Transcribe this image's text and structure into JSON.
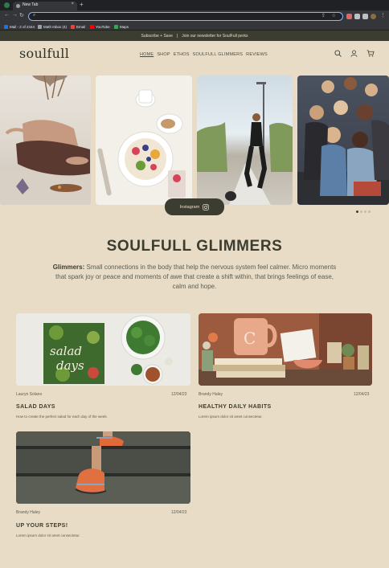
{
  "browser": {
    "tab_title": "New Tab",
    "tab_close": "×",
    "new_tab": "+",
    "back": "←",
    "forward": "→",
    "reload": "↻",
    "url": "",
    "omni_right": "⇪ ☆",
    "menu_glyph": "⋮",
    "bookmarks": [
      {
        "label": "Mail - 2 of 2444",
        "color": "#1a73e8"
      },
      {
        "label": "Math Inbox (4)",
        "color": "#9aa0a6"
      },
      {
        "label": "Email",
        "color": "#ea4335"
      },
      {
        "label": "YouTube",
        "color": "#ff0000"
      },
      {
        "label": "Maps",
        "color": "#34a853"
      }
    ]
  },
  "announcement": {
    "left": "Subscribe + Save",
    "sep": "|",
    "right": "Join our newsletter for SoulFull perks"
  },
  "header": {
    "logo": "soulfull",
    "nav": [
      "HOME",
      "SHOP",
      "ETHOS",
      "SOULFULL GLIMMERS",
      "REVIEWS"
    ]
  },
  "instagram": {
    "label": "Instagram"
  },
  "carousel": {
    "dots": 4,
    "active": 0
  },
  "section": {
    "title": "SOULFULL GLIMMERS",
    "intro_bold": "Glimmers:",
    "intro_text": " Small connections in the body that help the nervous system feel calmer. Micro moments that spark joy or peace and moments of awe that create a shift within, that brings feelings of ease, calm and hope."
  },
  "posts": [
    {
      "author": "Lauryn Solano",
      "date": "12/04/23",
      "title": "SALAD DAYS",
      "desc": "How to create the perfect salad for each day of the week.",
      "book_text_1": "salad",
      "book_text_2": "days"
    },
    {
      "author": "Brandy Haley",
      "date": "12/04/23",
      "title": "HEALTHY DAILY HABITS",
      "desc": "Lorem ipsum dolor sit amet consectetur.",
      "mug_letter": "C"
    },
    {
      "author": "Brandy Haley",
      "date": "12/04/23",
      "title": "UP YOUR STEPS!",
      "desc": "Lorem ipsum dolor sit amet consectetur."
    }
  ],
  "colors": {
    "background": "#e9dcc6",
    "accent_dark": "#3b3d31",
    "text": "#5a5c52"
  }
}
